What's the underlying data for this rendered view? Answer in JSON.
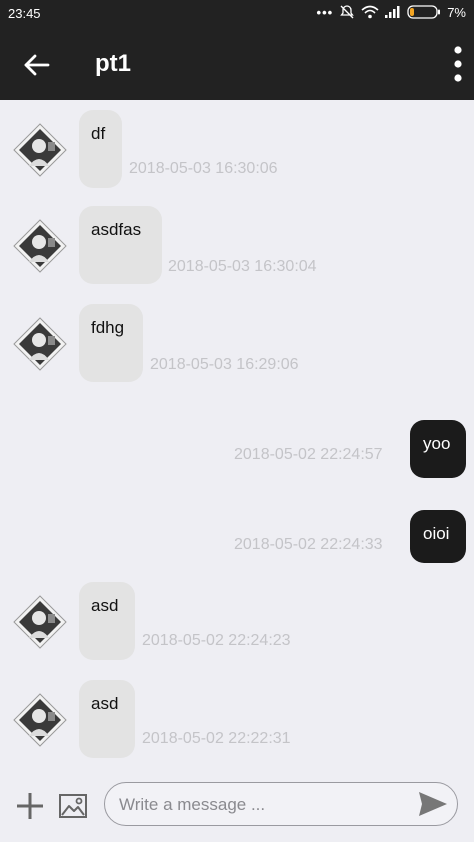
{
  "status_bar": {
    "time": "23:45",
    "battery": "7%"
  },
  "header": {
    "title": "pt1"
  },
  "messages": [
    {
      "direction": "incoming",
      "text": "df",
      "timestamp": "2018-05-03 16:30:06"
    },
    {
      "direction": "incoming",
      "text": "asdfas",
      "timestamp": "2018-05-03 16:30:04"
    },
    {
      "direction": "incoming",
      "text": "fdhg",
      "timestamp": "2018-05-03 16:29:06"
    },
    {
      "direction": "outgoing",
      "text": "yoo",
      "timestamp": "2018-05-02 22:24:57"
    },
    {
      "direction": "outgoing",
      "text": "oioi",
      "timestamp": "2018-05-02 22:24:33"
    },
    {
      "direction": "incoming",
      "text": "asd",
      "timestamp": "2018-05-02 22:24:23"
    },
    {
      "direction": "incoming",
      "text": "asd",
      "timestamp": "2018-05-02 22:22:31"
    }
  ],
  "composer": {
    "placeholder": "Write a message ..."
  },
  "icons": {
    "back": "arrow-left-icon",
    "more": "more-vertical-icon",
    "add": "plus-icon",
    "image": "image-icon",
    "send": "send-icon"
  }
}
